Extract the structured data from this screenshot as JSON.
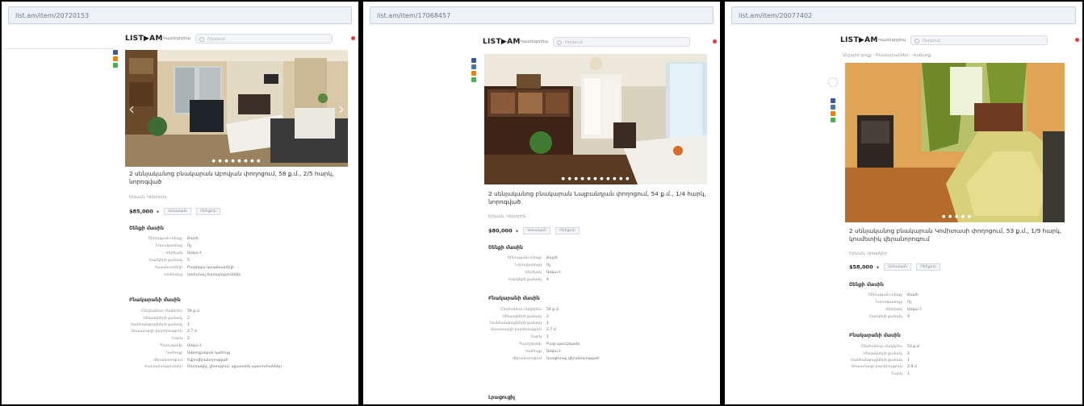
{
  "panes": [
    {
      "url": "list.am/item/20720153",
      "logo": "LIST▶AM",
      "categories_label": "Կատեգորիա",
      "search_placeholder": "Որոնում",
      "title": "2 սենյականոց բնակարան Աբովյան փողոցում, 58 ք.մ., 2/5 հարկ, նորոգված",
      "location": "Երևան, Կենտրոն",
      "price": "$85,000",
      "price_currency": "▾",
      "tag1": "Ամսական",
      "tag2": "Ռիելթոր",
      "building_section": "Շենքի մասին",
      "building": [
        {
          "k": "Շինության տիպը",
          "v": "Քարե"
        },
        {
          "k": "Նորակառույց",
          "v": "Ոչ"
        },
        {
          "k": "Վերելակ",
          "v": "Առկա է"
        },
        {
          "k": "Հարկերի քանակ",
          "v": "5"
        },
        {
          "k": "Կայանատեղի",
          "v": "Բացօթյա կայանատեղի"
        },
        {
          "k": "Կոմունալ",
          "v": "Կոմունալ ծառայություններ"
        }
      ],
      "apartment_section": "Բնակարանի մասին",
      "apartment": [
        {
          "k": "Ընդհանուր մակերես",
          "v": "58 ք.մ."
        },
        {
          "k": "Սենյակների քանակ",
          "v": "2"
        },
        {
          "k": "Սանհանգույցների քանակ",
          "v": "1"
        },
        {
          "k": "Առաստաղի բարձրություն",
          "v": "2.7 մ"
        },
        {
          "k": "Հարկ",
          "v": "2"
        },
        {
          "k": "Պատշգամբ",
          "v": "Առկա է"
        },
        {
          "k": "Կահույք",
          "v": "Ամբողջական կահույք"
        },
        {
          "k": "Վերանորոգում",
          "v": "Եվրովերանորոգված"
        },
        {
          "k": "Հարմարություններ",
          "v": "Օդորակիչ, ջեռուցում, պլաստիկ պատուհաններ"
        }
      ]
    },
    {
      "url": "list.am/item/17068457",
      "logo": "LIST▶AM",
      "categories_label": "Կատեգորիա",
      "search_placeholder": "Որոնում",
      "title": "2 սենյականոց բնակարան Նալբանդյան փողոցում, 54 ք.մ., 1/4 հարկ, նորոգված",
      "location": "Երևան, Կենտրոն",
      "price": "$80,000",
      "price_currency": "▾",
      "tag1": "Ամսական",
      "tag2": "Ռիելթոր",
      "building_section": "Շենքի մասին",
      "building": [
        {
          "k": "Շինության տիպը",
          "v": "Քարե"
        },
        {
          "k": "Նորակառույց",
          "v": "Ոչ"
        },
        {
          "k": "Վերելակ",
          "v": "Առկա է"
        },
        {
          "k": "Հարկերի քանակ",
          "v": "4"
        }
      ],
      "apartment_section": "Բնակարանի մասին",
      "apartment": [
        {
          "k": "Ընդհանուր մակերես",
          "v": "54 ք.մ."
        },
        {
          "k": "Սենյակների քանակ",
          "v": "2"
        },
        {
          "k": "Սանհանգույցների քանակ",
          "v": "1"
        },
        {
          "k": "Առաստաղի բարձրություն",
          "v": "2.7 մ"
        },
        {
          "k": "Հարկ",
          "v": "1"
        },
        {
          "k": "Պատշգամբ",
          "v": "Բաց պատշգամբ"
        },
        {
          "k": "Կահույք",
          "v": "Առկա է"
        },
        {
          "k": "Վերանորոգում",
          "v": "Կապիտալ վերանորոգված"
        }
      ],
      "extra_section": "Լրացուցիչ"
    },
    {
      "url": "list.am/item/20077402",
      "logo": "LIST▶AM",
      "categories_label": "Կատեգորիա",
      "search_placeholder": "Որոնում",
      "breadcrumb": "Անշարժ գույք › Բնակարաններ › Վաճառք",
      "title": "2 սենյականոց բնակարան Կոմիտասի փողոցում, 53 ք.մ., 1/9 հարկ, կոսմետիկ վերանորոգում",
      "location": "Երևան, Արաբկիր",
      "price": "$58,000",
      "price_currency": "▾",
      "tag1": "Ամսական",
      "tag2": "Ռիելթոր",
      "building_section": "Շենքի մասին",
      "building": [
        {
          "k": "Շինության տիպը",
          "v": "Քարե"
        },
        {
          "k": "Նորակառույց",
          "v": "Ոչ"
        },
        {
          "k": "Վերելակ",
          "v": "Առկա է"
        },
        {
          "k": "Հարկերի քանակ",
          "v": "9"
        }
      ],
      "apartment_section": "Բնակարանի մասին",
      "apartment": [
        {
          "k": "Ընդհանուր մակերես",
          "v": "53 ք.մ."
        },
        {
          "k": "Սենյակների քանակ",
          "v": "2"
        },
        {
          "k": "Սանհանգույցների քանակ",
          "v": "1"
        },
        {
          "k": "Առաստաղի բարձրություն",
          "v": "2.8 մ"
        },
        {
          "k": "Հարկ",
          "v": "1"
        }
      ]
    }
  ],
  "colors": {
    "social_fb": "#3b5998",
    "social_vk": "#4c75a3",
    "social_ok": "#ee8208",
    "social_wa": "#4caf50",
    "notif": "#e63c3c"
  },
  "icons": {
    "search": "search-icon",
    "notification": "notification-dot-icon",
    "prev": "chevron-left-icon",
    "next": "chevron-right-icon"
  }
}
